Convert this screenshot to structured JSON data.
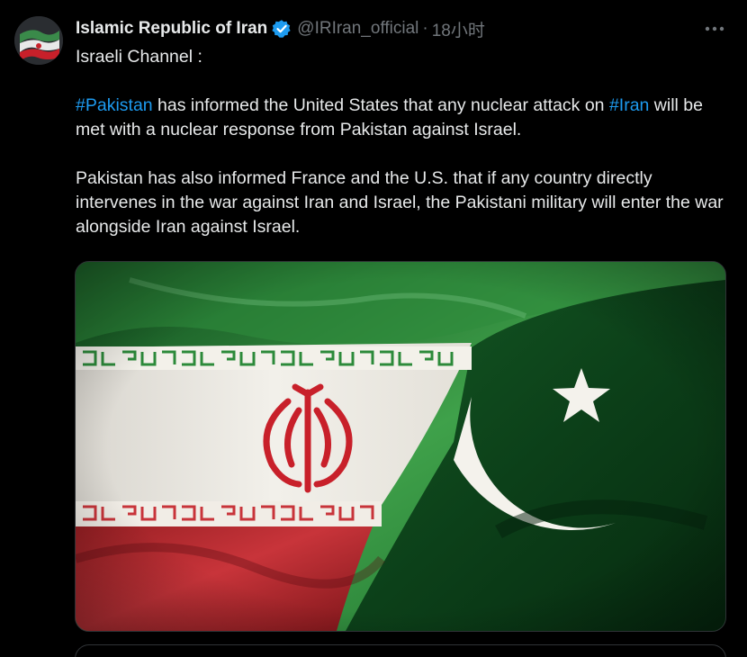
{
  "tweet": {
    "author": {
      "display_name": "Islamic Republic of Iran",
      "handle": "@IRIran_official",
      "separator": "·",
      "time": "18小时",
      "verified_color": "#1d9bf0"
    },
    "text": {
      "line1": "Israeli Channel :",
      "p2_hashtag1": "#Pakistan",
      "p2_part1": " has informed the United States that any nuclear attack on ",
      "p2_hashtag2": "#Iran",
      "p2_part2": " will be met with a nuclear response from Pakistan against Israel.",
      "p3": "Pakistan has also informed France and the U.S. that if any country directly intervenes in the war against Iran and Israel, the Pakistani military will enter the war alongside Iran against Israel."
    },
    "media": {
      "description_icon": "iran-pakistan-flags-image"
    },
    "colors": {
      "background": "#000000",
      "text": "#e7e9ea",
      "secondary": "#71767b",
      "link": "#1d9bf0"
    }
  }
}
